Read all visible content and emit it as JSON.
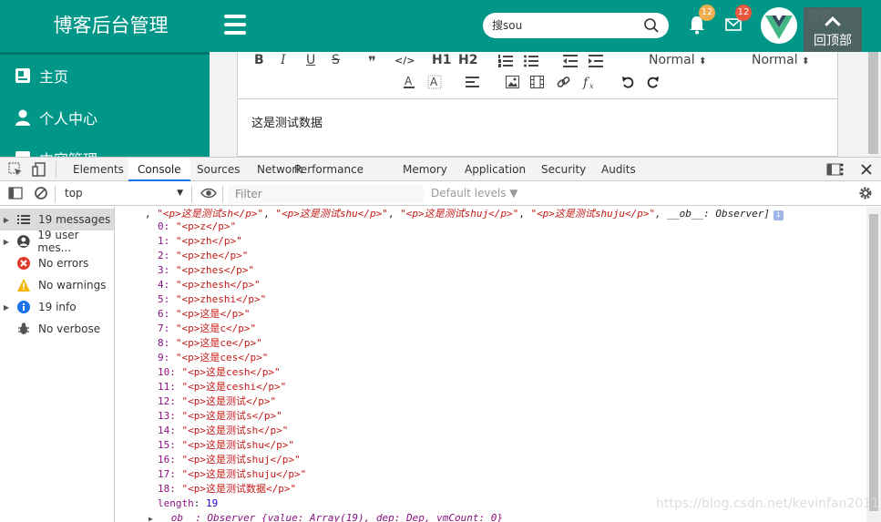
{
  "header": {
    "brand": "博客后台管理",
    "search_placeholder": "搜sou",
    "notifications_count": "12",
    "messages_count": "12",
    "user_name": "游客",
    "back_top_label": "回顶部",
    "colors": {
      "primary": "#009688",
      "badge_orange": "#f0ad4e",
      "badge_red": "#e9573f"
    }
  },
  "sidebar": {
    "items": [
      {
        "label": "主页",
        "icon": "home-icon"
      },
      {
        "label": "个人中心",
        "icon": "user-icon"
      },
      {
        "label": "内容管理",
        "icon": "content-icon"
      }
    ]
  },
  "editor": {
    "toolbar": {
      "bold": "B",
      "italic": "I",
      "underline": "U",
      "strike": "S",
      "quote": "❞",
      "code": "</>",
      "h1": "H1",
      "h2": "H2",
      "size_select": "Normal",
      "header_select": "Normal"
    },
    "content": "这是测试数据"
  },
  "devtools": {
    "tabs": [
      {
        "label": "Elements",
        "active": false
      },
      {
        "label": "Console",
        "active": true
      },
      {
        "label": "Sources",
        "active": false
      },
      {
        "label": "Network",
        "active": false
      },
      {
        "label": "Performance",
        "active": false
      },
      {
        "label": "Memory",
        "active": false
      },
      {
        "label": "Application",
        "active": false
      },
      {
        "label": "Security",
        "active": false
      },
      {
        "label": "Audits",
        "active": false
      }
    ],
    "context": "top",
    "filter_placeholder": "Filter",
    "levels_label": "Default levels ▼",
    "sidebar": [
      {
        "label": "19 messages",
        "icon": "list-icon",
        "expandable": true,
        "selected": true
      },
      {
        "label": "19 user mes...",
        "icon": "user-circle-icon",
        "expandable": true,
        "selected": false
      },
      {
        "label": "No errors",
        "icon": "error-icon",
        "expandable": false,
        "selected": false
      },
      {
        "label": "No warnings",
        "icon": "warning-icon",
        "expandable": false,
        "selected": false
      },
      {
        "label": "19 info",
        "icon": "info-icon",
        "expandable": true,
        "selected": false
      },
      {
        "label": "No verbose",
        "icon": "verbose-icon",
        "expandable": false,
        "selected": false
      }
    ],
    "console": {
      "summary_prefix": ", ",
      "summary_items": [
        "\"<p>这是测试sh</p>\"",
        "\"<p>这是测试shu</p>\"",
        "\"<p>这是测试shuj</p>\"",
        "\"<p>这是测试shuju</p>\""
      ],
      "summary_suffix": ", __ob__: Observer]",
      "entries": [
        {
          "index": "0:",
          "value": "\"<p>z</p>\""
        },
        {
          "index": "1:",
          "value": "\"<p>zh</p>\""
        },
        {
          "index": "2:",
          "value": "\"<p>zhe</p>\""
        },
        {
          "index": "3:",
          "value": "\"<p>zhes</p>\""
        },
        {
          "index": "4:",
          "value": "\"<p>zhesh</p>\""
        },
        {
          "index": "5:",
          "value": "\"<p>zheshi</p>\""
        },
        {
          "index": "6:",
          "value": "\"<p>这是</p>\""
        },
        {
          "index": "7:",
          "value": "\"<p>这是c</p>\""
        },
        {
          "index": "8:",
          "value": "\"<p>这是ce</p>\""
        },
        {
          "index": "9:",
          "value": "\"<p>这是ces</p>\""
        },
        {
          "index": "10:",
          "value": "\"<p>这是cesh</p>\""
        },
        {
          "index": "11:",
          "value": "\"<p>这是ceshi</p>\""
        },
        {
          "index": "12:",
          "value": "\"<p>这是测试</p>\""
        },
        {
          "index": "13:",
          "value": "\"<p>这是测试s</p>\""
        },
        {
          "index": "14:",
          "value": "\"<p>这是测试sh</p>\""
        },
        {
          "index": "15:",
          "value": "\"<p>这是测试shu</p>\""
        },
        {
          "index": "16:",
          "value": "\"<p>这是测试shuj</p>\""
        },
        {
          "index": "17:",
          "value": "\"<p>这是测试shuju</p>\""
        },
        {
          "index": "18:",
          "value": "\"<p>这是测试数据</p>\""
        }
      ],
      "length_key": "length",
      "length_value": "19",
      "ob_line": "__ob__: Observer {value: Array(19), dep: Dep, vmCount: 0}"
    },
    "watermark": "https://blog.csdn.net/kevinfan2011"
  }
}
